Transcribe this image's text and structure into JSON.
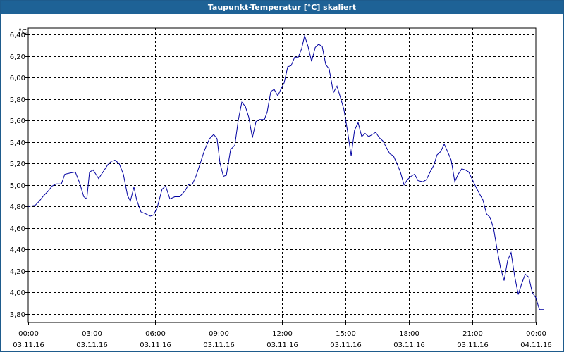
{
  "window": {
    "title": "Taupunkt-Temperatur [°C] skaliert"
  },
  "chart_data": {
    "type": "line",
    "title": "Taupunkt-Temperatur [°C] skaliert",
    "ylabel": "°C",
    "xlabel": "",
    "ylim": [
      3.72,
      6.46
    ],
    "xlim": [
      0,
      24
    ],
    "grid": true,
    "yticks": [
      3.8,
      4.0,
      4.2,
      4.4,
      4.6,
      4.8,
      5.0,
      5.2,
      5.4,
      5.6,
      5.8,
      6.0,
      6.2,
      6.4
    ],
    "ytick_labels": [
      "3,80",
      "4,00",
      "4,20",
      "4,40",
      "4,60",
      "4,80",
      "5,00",
      "5,20",
      "5,40",
      "5,60",
      "5,80",
      "6,00",
      "6,20",
      "6,40"
    ],
    "xtick_times": [
      "00:00",
      "03:00",
      "06:00",
      "09:00",
      "12:00",
      "15:00",
      "18:00",
      "21:00",
      "00:00"
    ],
    "xtick_dates": [
      "03.11.16",
      "03.11.16",
      "03.11.16",
      "03.11.16",
      "03.11.16",
      "03.11.16",
      "03.11.16",
      "03.11.16",
      "04.11.16"
    ],
    "series": [
      {
        "color": "#0000a0",
        "points": [
          [
            0.0,
            4.8
          ],
          [
            0.33,
            4.81
          ],
          [
            0.53,
            4.85
          ],
          [
            0.73,
            4.9
          ],
          [
            0.93,
            4.94
          ],
          [
            1.13,
            4.99
          ],
          [
            1.33,
            5.01
          ],
          [
            1.57,
            5.01
          ],
          [
            1.73,
            5.1
          ],
          [
            1.97,
            5.11
          ],
          [
            2.23,
            5.12
          ],
          [
            2.43,
            5.02
          ],
          [
            2.63,
            4.89
          ],
          [
            2.77,
            4.87
          ],
          [
            2.9,
            5.12
          ],
          [
            3.07,
            5.14
          ],
          [
            3.33,
            5.06
          ],
          [
            3.57,
            5.13
          ],
          [
            3.77,
            5.19
          ],
          [
            3.93,
            5.22
          ],
          [
            4.1,
            5.23
          ],
          [
            4.3,
            5.2
          ],
          [
            4.5,
            5.1
          ],
          [
            4.7,
            4.9
          ],
          [
            4.83,
            4.85
          ],
          [
            5.0,
            4.98
          ],
          [
            5.13,
            4.86
          ],
          [
            5.33,
            4.75
          ],
          [
            5.57,
            4.73
          ],
          [
            5.77,
            4.71
          ],
          [
            5.93,
            4.72
          ],
          [
            6.1,
            4.79
          ],
          [
            6.33,
            4.96
          ],
          [
            6.5,
            4.99
          ],
          [
            6.7,
            4.87
          ],
          [
            6.93,
            4.89
          ],
          [
            7.17,
            4.89
          ],
          [
            7.43,
            4.95
          ],
          [
            7.57,
            5.0
          ],
          [
            7.77,
            5.01
          ],
          [
            7.93,
            5.08
          ],
          [
            8.1,
            5.18
          ],
          [
            8.33,
            5.32
          ],
          [
            8.57,
            5.43
          ],
          [
            8.77,
            5.47
          ],
          [
            8.93,
            5.43
          ],
          [
            9.07,
            5.2
          ],
          [
            9.23,
            5.08
          ],
          [
            9.37,
            5.09
          ],
          [
            9.57,
            5.33
          ],
          [
            9.77,
            5.37
          ],
          [
            9.93,
            5.6
          ],
          [
            10.1,
            5.77
          ],
          [
            10.27,
            5.73
          ],
          [
            10.43,
            5.63
          ],
          [
            10.6,
            5.44
          ],
          [
            10.77,
            5.59
          ],
          [
            10.93,
            5.61
          ],
          [
            11.17,
            5.61
          ],
          [
            11.3,
            5.68
          ],
          [
            11.47,
            5.87
          ],
          [
            11.63,
            5.89
          ],
          [
            11.8,
            5.83
          ],
          [
            11.97,
            5.9
          ],
          [
            12.1,
            5.95
          ],
          [
            12.27,
            6.1
          ],
          [
            12.43,
            6.11
          ],
          [
            12.6,
            6.19
          ],
          [
            12.77,
            6.19
          ],
          [
            12.93,
            6.27
          ],
          [
            13.07,
            6.39
          ],
          [
            13.23,
            6.29
          ],
          [
            13.4,
            6.15
          ],
          [
            13.57,
            6.28
          ],
          [
            13.73,
            6.31
          ],
          [
            13.9,
            6.29
          ],
          [
            14.07,
            6.12
          ],
          [
            14.23,
            6.08
          ],
          [
            14.43,
            5.86
          ],
          [
            14.6,
            5.92
          ],
          [
            14.77,
            5.81
          ],
          [
            14.93,
            5.7
          ],
          [
            15.1,
            5.5
          ],
          [
            15.27,
            5.27
          ],
          [
            15.43,
            5.51
          ],
          [
            15.6,
            5.58
          ],
          [
            15.77,
            5.45
          ],
          [
            15.93,
            5.48
          ],
          [
            16.1,
            5.45
          ],
          [
            16.27,
            5.47
          ],
          [
            16.43,
            5.49
          ],
          [
            16.6,
            5.44
          ],
          [
            16.77,
            5.41
          ],
          [
            16.93,
            5.35
          ],
          [
            17.1,
            5.29
          ],
          [
            17.27,
            5.27
          ],
          [
            17.43,
            5.2
          ],
          [
            17.6,
            5.12
          ],
          [
            17.77,
            5.0
          ],
          [
            17.93,
            5.05
          ],
          [
            18.1,
            5.08
          ],
          [
            18.27,
            5.1
          ],
          [
            18.43,
            5.04
          ],
          [
            18.67,
            5.03
          ],
          [
            18.83,
            5.05
          ],
          [
            19.0,
            5.12
          ],
          [
            19.17,
            5.18
          ],
          [
            19.33,
            5.28
          ],
          [
            19.5,
            5.31
          ],
          [
            19.67,
            5.38
          ],
          [
            19.83,
            5.31
          ],
          [
            20.0,
            5.23
          ],
          [
            20.17,
            5.03
          ],
          [
            20.33,
            5.1
          ],
          [
            20.5,
            5.15
          ],
          [
            20.67,
            5.14
          ],
          [
            20.83,
            5.12
          ],
          [
            21.0,
            5.05
          ],
          [
            21.17,
            4.98
          ],
          [
            21.33,
            4.92
          ],
          [
            21.5,
            4.86
          ],
          [
            21.67,
            4.73
          ],
          [
            21.83,
            4.7
          ],
          [
            22.0,
            4.6
          ],
          [
            22.17,
            4.4
          ],
          [
            22.33,
            4.23
          ],
          [
            22.5,
            4.11
          ],
          [
            22.67,
            4.3
          ],
          [
            22.83,
            4.37
          ],
          [
            23.0,
            4.15
          ],
          [
            23.17,
            3.98
          ],
          [
            23.33,
            4.08
          ],
          [
            23.5,
            4.17
          ],
          [
            23.67,
            4.14
          ],
          [
            23.83,
            4.0
          ],
          [
            24.0,
            3.95
          ],
          [
            24.17,
            3.84
          ],
          [
            24.4,
            3.84
          ]
        ]
      }
    ]
  }
}
